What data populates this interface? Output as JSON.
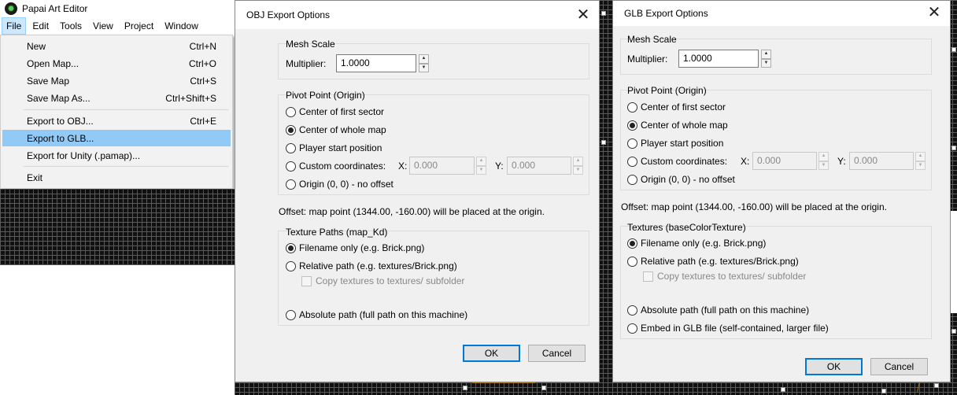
{
  "app": {
    "title": "Papai Art Editor",
    "icon": "app-logo-icon",
    "menus": [
      "File",
      "Edit",
      "Tools",
      "View",
      "Project",
      "Window"
    ],
    "file_menu": [
      {
        "label": "New",
        "shortcut": "Ctrl+N"
      },
      {
        "label": "Open Map...",
        "shortcut": "Ctrl+O"
      },
      {
        "label": "Save Map",
        "shortcut": "Ctrl+S"
      },
      {
        "label": "Save Map As...",
        "shortcut": "Ctrl+Shift+S"
      },
      {
        "label": "Export to OBJ...",
        "shortcut": "Ctrl+E"
      },
      {
        "label": "Export to GLB...",
        "shortcut": ""
      },
      {
        "label": "Export for Unity (.pamap)...",
        "shortcut": ""
      },
      {
        "label": "Exit",
        "shortcut": ""
      }
    ]
  },
  "obj_dialog": {
    "title": "OBJ Export Options",
    "mesh_scale": {
      "title": "Mesh Scale",
      "multiplier_label": "Multiplier:",
      "multiplier_value": "1.0000"
    },
    "pivot": {
      "title": "Pivot Point (Origin)",
      "options": [
        "Center of first sector",
        "Center of whole map",
        "Player start position",
        "Custom coordinates:",
        "Origin (0, 0) - no offset"
      ],
      "x_label": "X:",
      "x_value": "0.000",
      "y_label": "Y:",
      "y_value": "0.000"
    },
    "offset_text": "Offset: map point (1344.00, -160.00) will be placed at the origin.",
    "textures": {
      "title": "Texture Paths (map_Kd)",
      "filename_only": "Filename only  (e.g. Brick.png)",
      "relative_path": "Relative path  (e.g. textures/Brick.png)",
      "copy_textures": "Copy textures to textures/ subfolder",
      "absolute_path": "Absolute path  (full path on this machine)"
    },
    "ok": "OK",
    "cancel": "Cancel"
  },
  "glb_dialog": {
    "title": "GLB Export Options",
    "mesh_scale": {
      "title": "Mesh Scale",
      "multiplier_label": "Multiplier:",
      "multiplier_value": "1.0000"
    },
    "pivot": {
      "title": "Pivot Point (Origin)",
      "options": [
        "Center of first sector",
        "Center of whole map",
        "Player start position",
        "Custom coordinates:",
        "Origin (0, 0) - no offset"
      ],
      "x_label": "X:",
      "x_value": "0.000",
      "y_label": "Y:",
      "y_value": "0.000"
    },
    "offset_text": "Offset: map point (1344.00, -160.00) will be placed at the origin.",
    "textures": {
      "title": "Textures (baseColorTexture)",
      "filename_only": "Filename only  (e.g. Brick.png)",
      "relative_path": "Relative path  (e.g. textures/Brick.png)",
      "copy_textures": "Copy textures to textures/ subfolder",
      "absolute_path": "Absolute path  (full path on this machine)",
      "embed": "Embed in GLB file  (self-contained, larger file)"
    },
    "ok": "OK",
    "cancel": "Cancel"
  },
  "glyphs": {
    "close": "✕",
    "up": "▲",
    "down": "▼",
    "logo": "✹"
  }
}
